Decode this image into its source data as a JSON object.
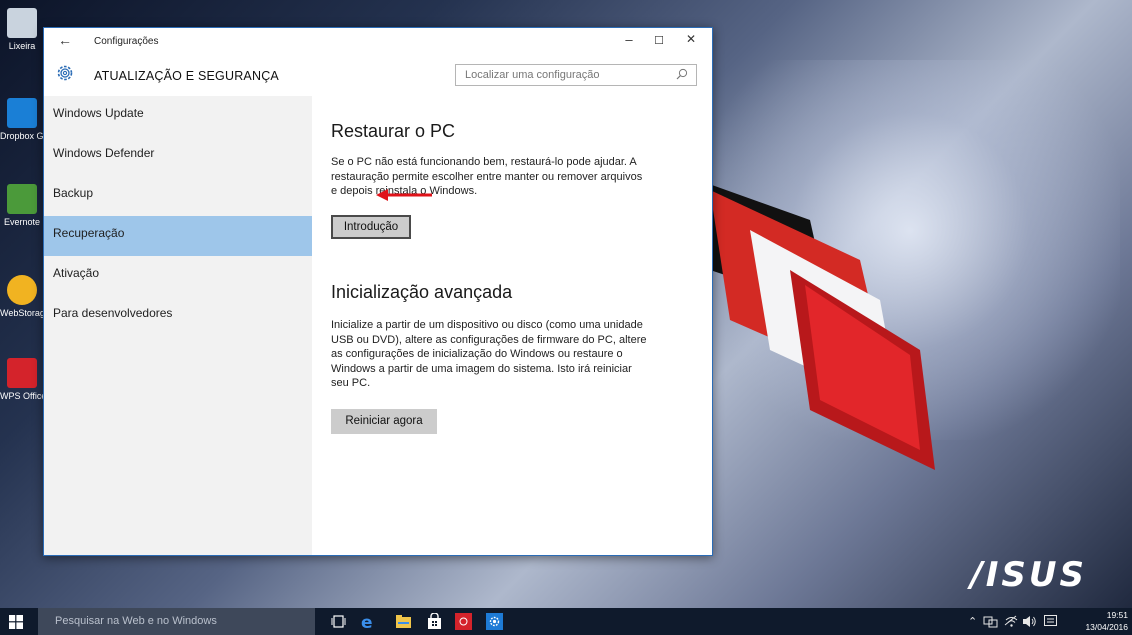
{
  "desktop": {
    "icons": [
      {
        "label": "Lixeira"
      },
      {
        "label": "Dropbox GB"
      },
      {
        "label": "Evernote"
      },
      {
        "label": "WebStorage"
      },
      {
        "label": "WPS Office"
      }
    ],
    "brand": "/ISUS"
  },
  "window": {
    "title": "Configurações",
    "controls": {
      "minimize": "–",
      "maximize": "☐",
      "close": "✕"
    },
    "header_title": "ATUALIZAÇÃO E SEGURANÇA",
    "search": {
      "placeholder": "Localizar uma configuração"
    },
    "sidebar": {
      "items": [
        {
          "label": "Windows Update"
        },
        {
          "label": "Windows Defender"
        },
        {
          "label": "Backup"
        },
        {
          "label": "Recuperação",
          "selected": true
        },
        {
          "label": "Ativação"
        },
        {
          "label": "Para desenvolvedores"
        }
      ]
    },
    "content": {
      "reset": {
        "title": "Restaurar o PC",
        "lines": [
          "Se o PC não está funcionando bem, restaurá-lo pode ajudar. A",
          "restauração permite escolher entre manter ou remover arquivos",
          "e depois reinstala o Windows."
        ],
        "button": "Introdução"
      },
      "advanced": {
        "title": "Inicialização avançada",
        "lines": [
          "Inicialize a partir de um dispositivo ou disco (como uma unidade",
          "USB ou DVD), altere as configurações de firmware do PC, altere",
          "as configurações de inicialização do Windows ou restaure o",
          "Windows a partir de uma imagem do sistema. Isto irá reiniciar",
          "seu PC."
        ],
        "button": "Reiniciar agora"
      }
    }
  },
  "taskbar": {
    "search_placeholder": "Pesquisar na Web e no Windows",
    "time": "19:51",
    "date": "13/04/2016"
  },
  "colors": {
    "accent": "#2b6cb6",
    "selected_nav": "#9ec6ea",
    "annotation_arrow": "#e0131a"
  }
}
